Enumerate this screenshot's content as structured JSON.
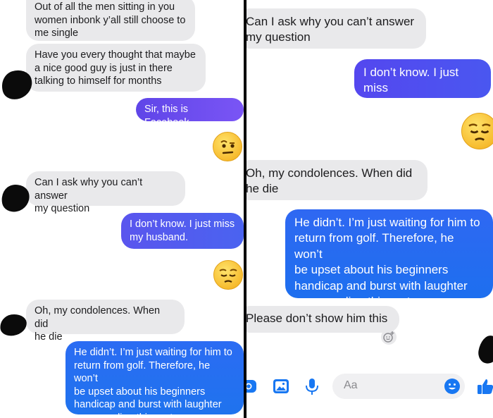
{
  "colors": {
    "incoming_bubble": "#e9e9eb",
    "outgoing_purple": "#6a4cf3",
    "outgoing_blue": "#1a73f0",
    "accent": "#1877f2"
  },
  "left": {
    "messages": [
      {
        "dir": "in",
        "text": "Out of all the men sitting in you\nwomen inbonk y’all still choose to\nme single"
      },
      {
        "dir": "in",
        "text": "Have you every thought that maybe\na nice good guy is just in there\ntalking to himself for months"
      },
      {
        "dir": "out",
        "text": "Sir, this is Facebook."
      },
      {
        "dir": "in",
        "text": "Can I ask why you can’t answer\nmy question"
      },
      {
        "dir": "out",
        "text": "I don’t know. I just miss\nmy husband."
      },
      {
        "dir": "in",
        "text": "Oh, my condolences. When did\nhe die"
      },
      {
        "dir": "out",
        "text": "He didn’t. I’m just waiting for him to\nreturn from golf. Therefore, he won’t\nbe upset about his beginners\nhandicap and burst with laughter\nupon reading this rant."
      }
    ],
    "emojis": [
      "raised-eyebrow-emoji",
      "pensive-emoji"
    ]
  },
  "right": {
    "messages": [
      {
        "dir": "in",
        "text": "Can I ask why you can’t answer\nmy question"
      },
      {
        "dir": "out",
        "text": "I don’t know. I just miss\nmy husband."
      },
      {
        "dir": "in",
        "text": "Oh, my condolences. When did\nhe die"
      },
      {
        "dir": "out",
        "text": "He didn’t. I’m just waiting for him to\nreturn from golf. Therefore, he won’t\nbe upset about his beginners\nhandicap and burst with laughter\nupon reading this rant."
      },
      {
        "dir": "in",
        "text": "Please don’t show him this"
      }
    ],
    "emojis": [
      "pensive-emoji",
      "add-reaction-icon"
    ],
    "composer": {
      "placeholder": "Aa",
      "icons": [
        "camera-icon",
        "photo-icon",
        "microphone-icon",
        "emoji-icon",
        "thumbs-up-icon"
      ]
    }
  }
}
